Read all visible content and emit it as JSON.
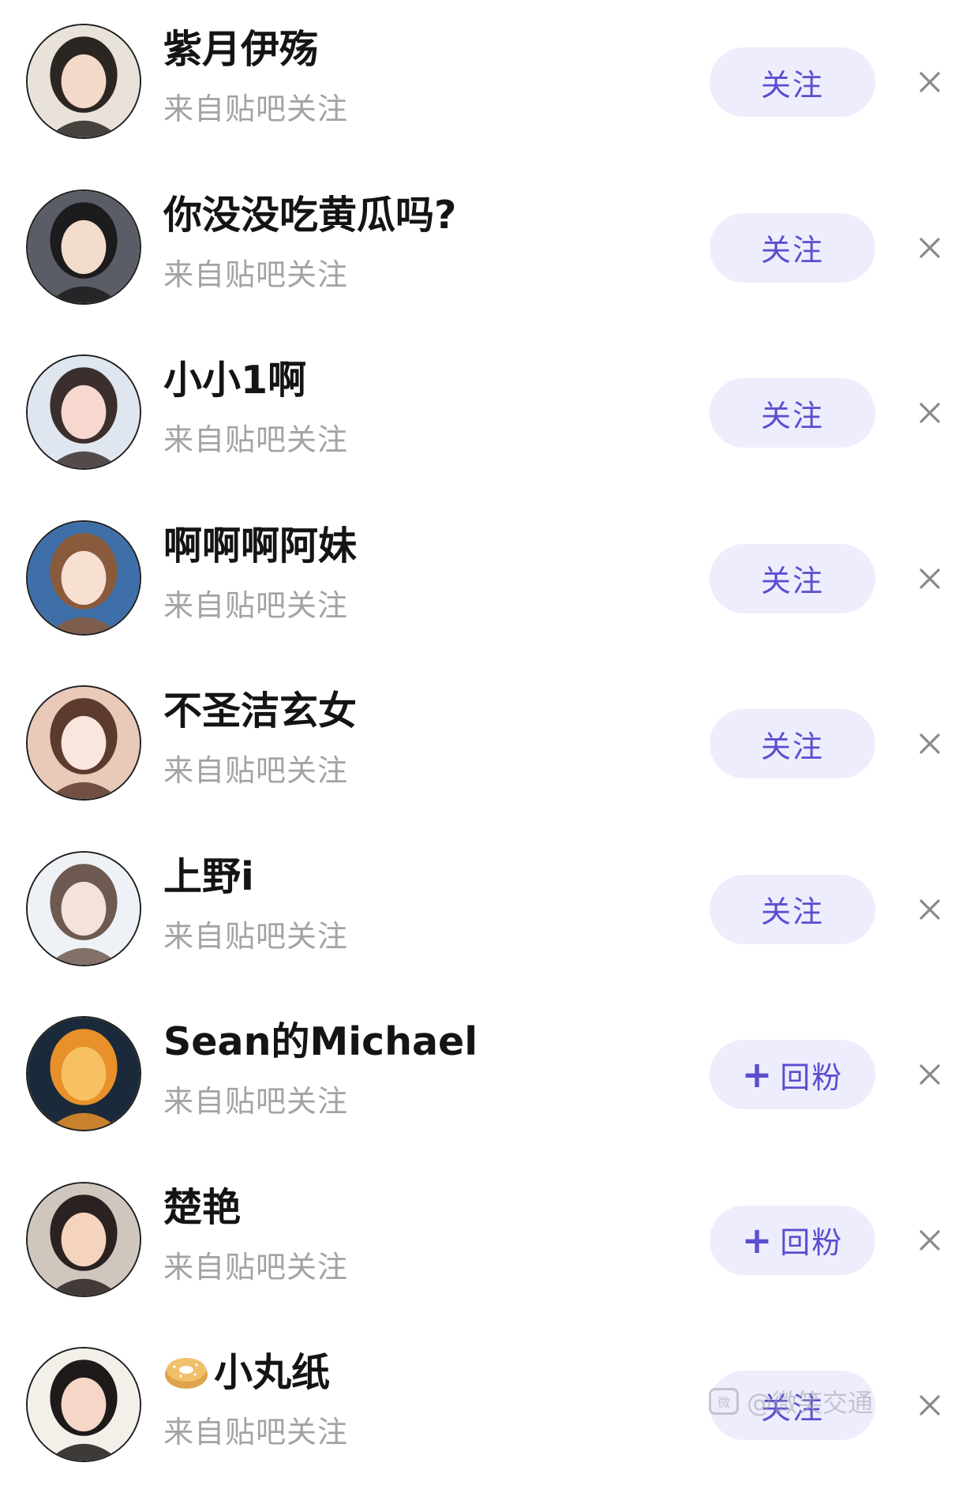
{
  "follow_list": {
    "items": [
      {
        "name": "紫月伊殇",
        "source": "来自贴吧关注",
        "action": "关注",
        "action_type": "follow",
        "avatar_colors": [
          "#e8e2da",
          "#2b2622",
          "#f3d9c8"
        ]
      },
      {
        "name": "你没没吃黄瓜吗?",
        "source": "来自贴吧关注",
        "action": "关注",
        "action_type": "follow",
        "avatar_colors": [
          "#5a5d66",
          "#1c1b1d",
          "#f4dccc"
        ]
      },
      {
        "name": "小小1啊",
        "source": "来自贴吧关注",
        "action": "关注",
        "action_type": "follow",
        "avatar_colors": [
          "#dfe6ef",
          "#3a2f2c",
          "#f6d8cf"
        ]
      },
      {
        "name": "啊啊啊阿妹",
        "source": "来自贴吧关注",
        "action": "关注",
        "action_type": "follow",
        "avatar_colors": [
          "#3f6fa8",
          "#8a5a3c",
          "#f7e0d2"
        ]
      },
      {
        "name": "不圣洁玄女",
        "source": "来自贴吧关注",
        "action": "关注",
        "action_type": "follow",
        "avatar_colors": [
          "#e9c9b8",
          "#5c3a2e",
          "#f9e6dc"
        ]
      },
      {
        "name": "上野i",
        "source": "来自贴吧关注",
        "action": "关注",
        "action_type": "follow",
        "avatar_colors": [
          "#eef2f6",
          "#6e5a50",
          "#f3e3da"
        ]
      },
      {
        "name": "Sean的Michael",
        "source": "来自贴吧关注",
        "action": "回粉",
        "action_type": "follow-back",
        "avatar_colors": [
          "#1a2a3a",
          "#e8902a",
          "#f7c060"
        ]
      },
      {
        "name": "楚艳",
        "source": "来自贴吧关注",
        "action": "回粉",
        "action_type": "follow-back",
        "avatar_colors": [
          "#cfc6bd",
          "#2a2220",
          "#f5d4bf"
        ]
      },
      {
        "name": "小丸纸",
        "source": "来自贴吧关注",
        "action": "关注",
        "action_type": "follow",
        "emoji": "donut",
        "avatar_colors": [
          "#f3efe9",
          "#1d1a19",
          "#f6d6c6"
        ]
      }
    ],
    "plus_glyph": "+",
    "close_icon": "close-x-icon"
  },
  "watermark": {
    "text": "@微笑交通"
  },
  "colors": {
    "button_bg": "#eeedfd",
    "button_text": "#5a4fcf",
    "name_text": "#141414",
    "source_text": "#a3a3a3"
  }
}
